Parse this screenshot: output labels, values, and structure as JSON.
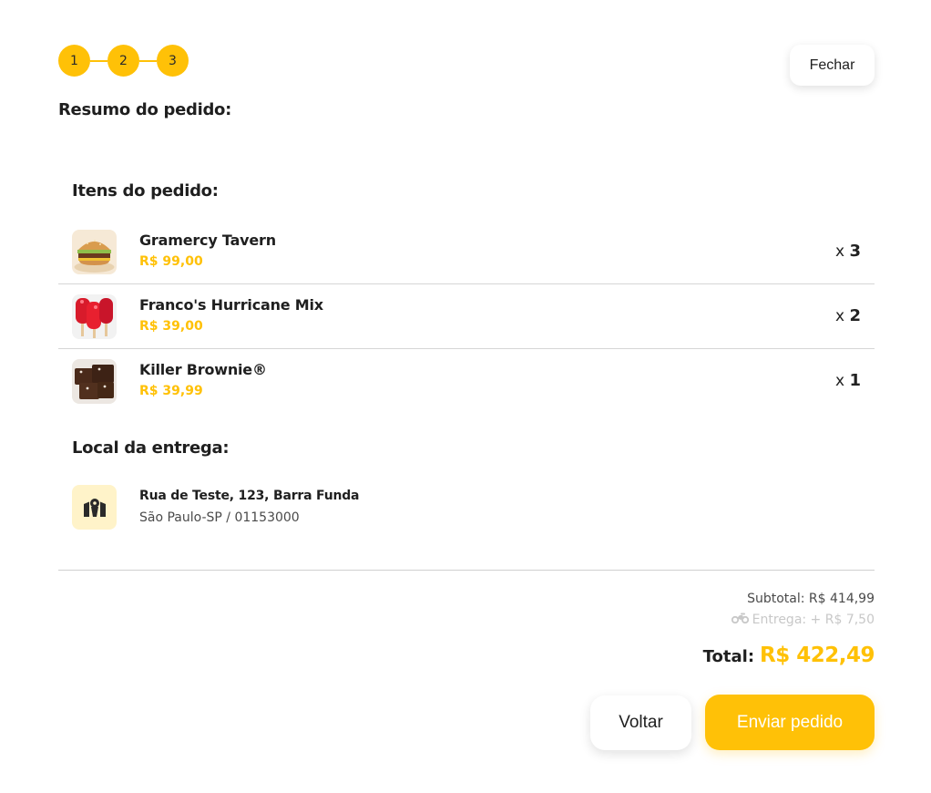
{
  "stepper": {
    "steps": [
      "1",
      "2",
      "3"
    ],
    "current": 3
  },
  "header": {
    "close_label": "Fechar",
    "title": "Resumo do pedido:"
  },
  "items_section": {
    "title": "Itens do pedido:",
    "items": [
      {
        "name": "Gramercy Tavern",
        "price": "R$ 99,00",
        "qty_prefix": "x",
        "qty": "3",
        "image": "burger-image"
      },
      {
        "name": "Franco's Hurricane Mix",
        "price": "R$ 39,00",
        "qty_prefix": "x",
        "qty": "2",
        "image": "popsicles-image"
      },
      {
        "name": "Killer Brownie®",
        "price": "R$ 39,99",
        "qty_prefix": "x",
        "qty": "1",
        "image": "brownie-image"
      }
    ]
  },
  "delivery_section": {
    "title": "Local da entrega:",
    "icon": "map-marker-icon",
    "line1": "Rua de Teste, 123, Barra Funda",
    "line2": "São Paulo-SP / 01153000"
  },
  "summary": {
    "subtotal": "Subtotal: R$ 414,99",
    "delivery_icon": "motorcycle-icon",
    "delivery": "Entrega: + R$ 7,50",
    "total_label": "Total:",
    "total_value": "R$ 422,49"
  },
  "actions": {
    "back_label": "Voltar",
    "send_label": "Enviar pedido"
  },
  "colors": {
    "accent": "#ffc107",
    "accent_light": "#fff3c9",
    "text": "#1f1f1f",
    "muted": "#c8c8c8"
  }
}
